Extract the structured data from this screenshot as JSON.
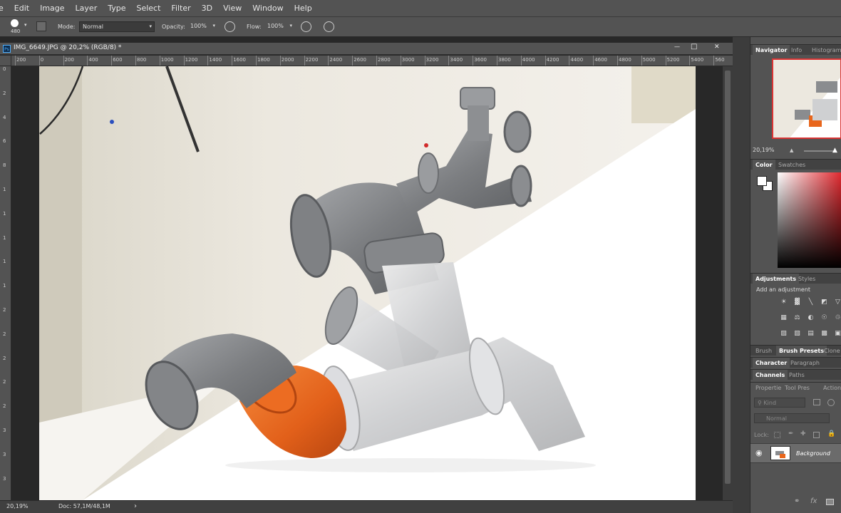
{
  "menu": [
    "e",
    "Edit",
    "Image",
    "Layer",
    "Type",
    "Select",
    "Filter",
    "3D",
    "View",
    "Window",
    "Help"
  ],
  "options": {
    "brush_size": "480",
    "mode_label": "Mode:",
    "mode_value": "Normal",
    "opacity_label": "Opacity:",
    "opacity_value": "100%",
    "flow_label": "Flow:",
    "flow_value": "100%"
  },
  "document": {
    "ps_badge": "Ps",
    "tab_title": "IMG_6649.JPG @ 20,2% (RGB/8) *",
    "minimize": "—",
    "maximize": "□",
    "close": "✕"
  },
  "ruler_top": [
    "200",
    "0",
    "200",
    "400",
    "600",
    "800",
    "1000",
    "1200",
    "1400",
    "1600",
    "1800",
    "2000",
    "2200",
    "2400",
    "2600",
    "2800",
    "3000",
    "3200",
    "3400",
    "3600",
    "3800",
    "4000",
    "4200",
    "4400",
    "4600",
    "4800",
    "5000",
    "5200",
    "5400",
    "560"
  ],
  "ruler_left": [
    "0",
    "2",
    "4",
    "6",
    "8",
    "1",
    "1",
    "1",
    "1",
    "1",
    "2",
    "2",
    "2",
    "2",
    "2",
    "3",
    "3",
    "3"
  ],
  "status": {
    "zoom": "20,19%",
    "doc": "Doc: 57,1M/48,1M",
    "arrow": "›"
  },
  "navigator": {
    "tabs": [
      "Navigator",
      "Info",
      "Histogram"
    ],
    "zoom": "20,19%"
  },
  "color_panel": {
    "tabs": [
      "Color",
      "Swatches"
    ]
  },
  "adjustments": {
    "tabs": [
      "Adjustments",
      "Styles"
    ],
    "hint": "Add an adjustment",
    "icon_rows": [
      [
        "sun-icon",
        "levels-icon",
        "curves-icon",
        "exposure-icon",
        "vibrance-icon"
      ],
      [
        "hue-icon",
        "balance-icon",
        "bw-icon",
        "photo-filter-icon",
        "mixer-icon"
      ],
      [
        "invert-icon",
        "posterize-icon",
        "threshold-icon",
        "gradient-map-icon",
        "selective-icon"
      ]
    ]
  },
  "brush_tabs": [
    "Brush",
    "Brush Presets",
    "Clone"
  ],
  "char_tabs": [
    "Character",
    "Paragraph"
  ],
  "channel_tabs": [
    "Channels",
    "Paths"
  ],
  "prop_tabs": [
    "Propertie",
    "Tool Pres",
    "Actions"
  ],
  "layers": {
    "kind_placeholder": "Kind",
    "blend": "Normal",
    "lock_label": "Lock:",
    "layer_name": "Background"
  },
  "colors": {
    "chrome": "#535353",
    "dark": "#282828",
    "pipe_gray": "#8a8c8f",
    "pipe_orange": "#e8661c"
  }
}
